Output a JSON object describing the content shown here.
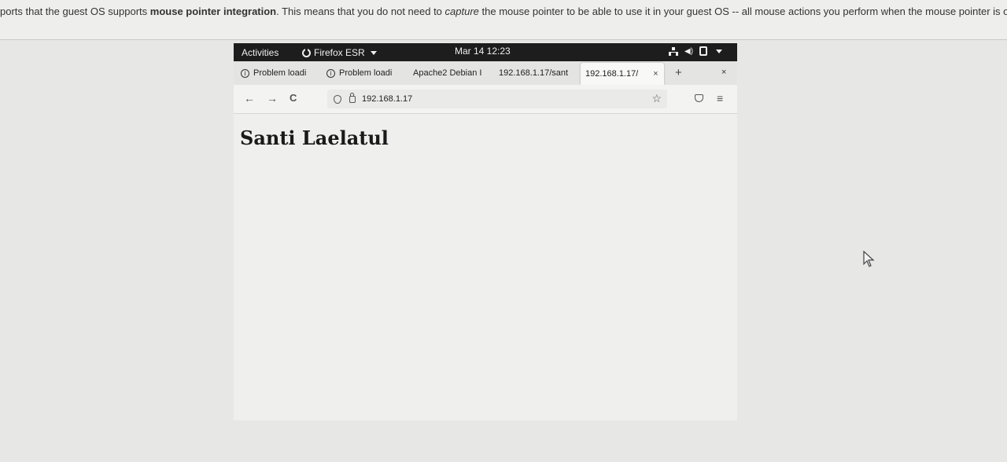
{
  "notice": {
    "part1": "ports that the guest OS supports ",
    "bold": "mouse pointer integration",
    "part2": ". This means that you do not need to ",
    "italic": "capture",
    "part3": " the mouse pointer to be able to use it in your guest OS -- all mouse actions you perform when the mouse pointer is ov"
  },
  "topbar": {
    "activities": "Activities",
    "app_name": "Firefox ESR",
    "clock": "Mar 14  12:23"
  },
  "tabs": [
    {
      "label": "Problem loadi"
    },
    {
      "label": "Problem loadi"
    },
    {
      "label": "Apache2 Debian I"
    },
    {
      "label": "192.168.1.17/sant"
    },
    {
      "label": "192.168.1.17/"
    }
  ],
  "new_tab_label": "+",
  "tab_close_label": "×",
  "window_close_label": "×",
  "nav": {
    "back": "←",
    "forward": "→",
    "reload": "C",
    "url": "192.168.1.17",
    "star": "☆",
    "menu": "≡"
  },
  "page": {
    "heading": "Santi Laelatul"
  },
  "icons": {
    "shield": "shield-icon",
    "lock": "lock-icon",
    "pocket": "pocket-icon",
    "network": "network-icon",
    "volume": "volume-icon",
    "power": "power-icon"
  },
  "colors": {
    "topbar_bg": "#1d1d1d",
    "tabstrip_bg": "#e4e4e2",
    "page_bg": "#efefee"
  }
}
